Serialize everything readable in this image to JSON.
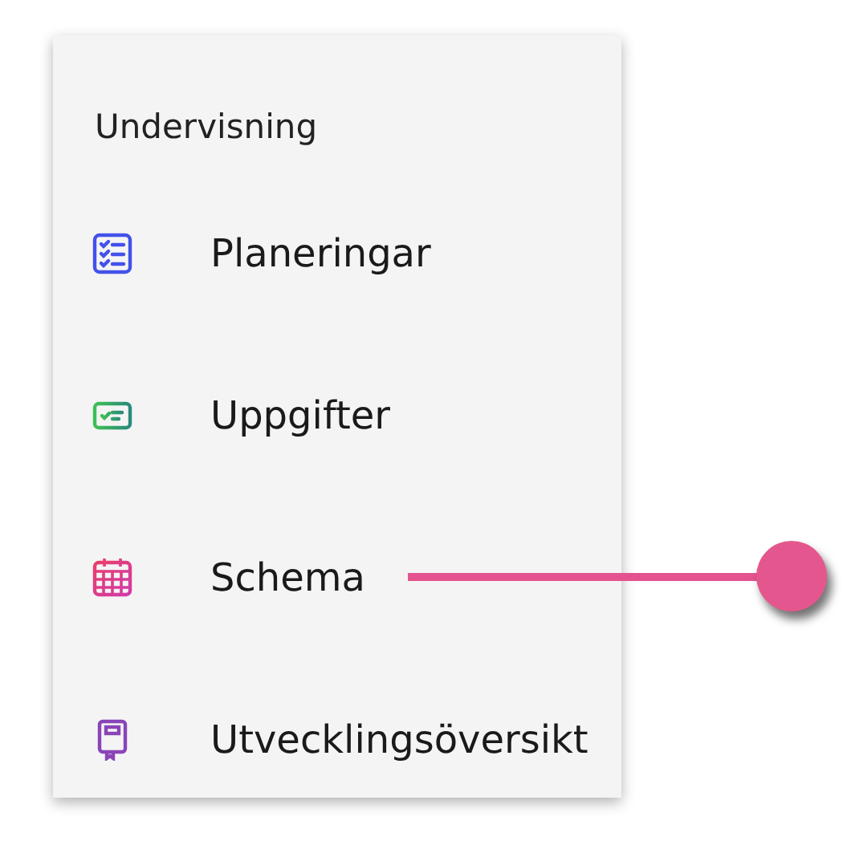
{
  "menu": {
    "heading": "Undervisning",
    "items": [
      {
        "kind": "checklist",
        "label": "Planeringar",
        "pointed": false
      },
      {
        "kind": "ticket",
        "label": "Uppgifter",
        "pointed": false
      },
      {
        "kind": "calendar",
        "label": "Schema",
        "pointed": true
      },
      {
        "kind": "book",
        "label": "Utvecklingsöversikt",
        "pointed": false
      }
    ]
  }
}
